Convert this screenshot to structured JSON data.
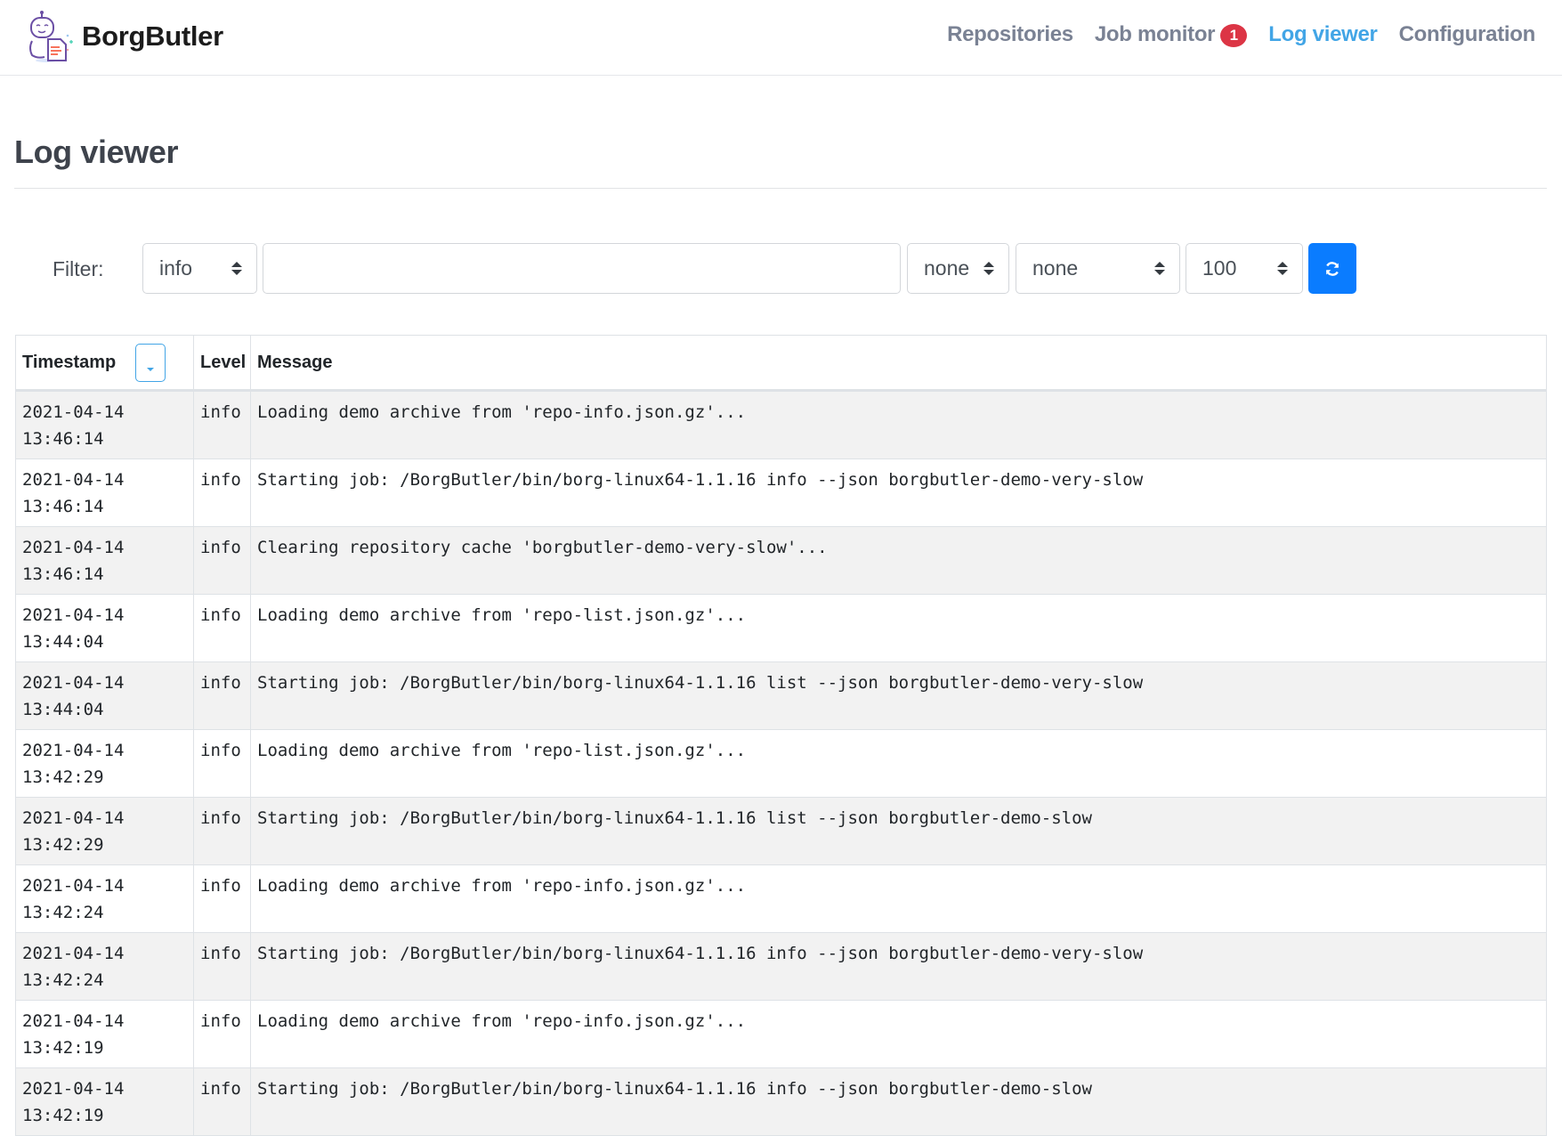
{
  "app": {
    "brand": "BorgButler",
    "logo_icon": "robot-document-logo"
  },
  "nav": {
    "items": [
      {
        "label": "Repositories",
        "active": false
      },
      {
        "label": "Job monitor",
        "active": false,
        "badge": "1"
      },
      {
        "label": "Log viewer",
        "active": true
      },
      {
        "label": "Configuration",
        "active": false
      }
    ],
    "accent_color": "#42a5e6",
    "badge_color": "#dc3545"
  },
  "page": {
    "title": "Log viewer"
  },
  "filter": {
    "label": "Filter:",
    "level_select": "info",
    "search_value": "",
    "select_2": "none",
    "select_3": "none",
    "limit_select": "100",
    "refresh_icon": "refresh-icon",
    "button_color": "#0a7cff"
  },
  "table": {
    "columns": [
      "Timestamp",
      "Level",
      "Message"
    ],
    "sort_icon": "sort-descending-icon",
    "rows": [
      {
        "date": "2021-04-14",
        "time": "13:46:14",
        "level": "info",
        "message": "Loading demo archive from 'repo-info.json.gz'..."
      },
      {
        "date": "2021-04-14",
        "time": "13:46:14",
        "level": "info",
        "message": "Starting job: /BorgButler/bin/borg-linux64-1.1.16 info --json borgbutler-demo-very-slow"
      },
      {
        "date": "2021-04-14",
        "time": "13:46:14",
        "level": "info",
        "message": "Clearing repository cache 'borgbutler-demo-very-slow'..."
      },
      {
        "date": "2021-04-14",
        "time": "13:44:04",
        "level": "info",
        "message": "Loading demo archive from 'repo-list.json.gz'..."
      },
      {
        "date": "2021-04-14",
        "time": "13:44:04",
        "level": "info",
        "message": "Starting job: /BorgButler/bin/borg-linux64-1.1.16 list --json borgbutler-demo-very-slow"
      },
      {
        "date": "2021-04-14",
        "time": "13:42:29",
        "level": "info",
        "message": "Loading demo archive from 'repo-list.json.gz'..."
      },
      {
        "date": "2021-04-14",
        "time": "13:42:29",
        "level": "info",
        "message": "Starting job: /BorgButler/bin/borg-linux64-1.1.16 list --json borgbutler-demo-slow"
      },
      {
        "date": "2021-04-14",
        "time": "13:42:24",
        "level": "info",
        "message": "Loading demo archive from 'repo-info.json.gz'..."
      },
      {
        "date": "2021-04-14",
        "time": "13:42:24",
        "level": "info",
        "message": "Starting job: /BorgButler/bin/borg-linux64-1.1.16 info --json borgbutler-demo-very-slow"
      },
      {
        "date": "2021-04-14",
        "time": "13:42:19",
        "level": "info",
        "message": "Loading demo archive from 'repo-info.json.gz'..."
      },
      {
        "date": "2021-04-14",
        "time": "13:42:19",
        "level": "info",
        "message": "Starting job: /BorgButler/bin/borg-linux64-1.1.16 info --json borgbutler-demo-slow"
      }
    ]
  }
}
